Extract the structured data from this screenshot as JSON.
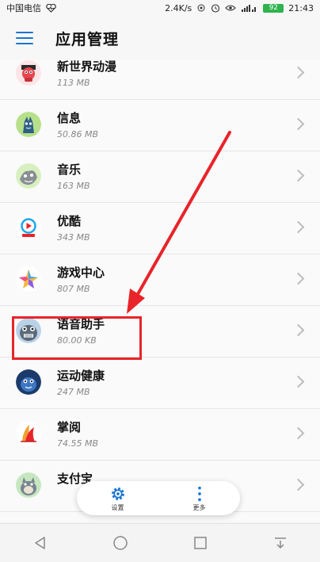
{
  "status_bar": {
    "carrier": "中国电信",
    "speed": "2.4K/s",
    "battery": "92",
    "time": "21:43"
  },
  "app_bar": {
    "title": "应用管理"
  },
  "apps": [
    {
      "name": "新世界动漫",
      "size": "113 MB",
      "icon": "anime-app-icon"
    },
    {
      "name": "信息",
      "size": "50.86 MB",
      "icon": "messages-app-icon"
    },
    {
      "name": "音乐",
      "size": "163 MB",
      "icon": "music-app-icon"
    },
    {
      "name": "优酷",
      "size": "343 MB",
      "icon": "youku-app-icon"
    },
    {
      "name": "游戏中心",
      "size": "807 MB",
      "icon": "game-center-app-icon"
    },
    {
      "name": "语音助手",
      "size": "80.00 KB",
      "icon": "voice-assistant-app-icon"
    },
    {
      "name": "运动健康",
      "size": "247 MB",
      "icon": "sports-health-app-icon"
    },
    {
      "name": "掌阅",
      "size": "74.55 MB",
      "icon": "ireader-app-icon"
    },
    {
      "name": "支付宝",
      "size": "",
      "icon": "alipay-app-icon"
    }
  ],
  "bottom_panel": {
    "settings_label": "设置",
    "more_label": "更多"
  },
  "colors": {
    "accent": "#1976d2",
    "highlight": "#e8242a"
  }
}
